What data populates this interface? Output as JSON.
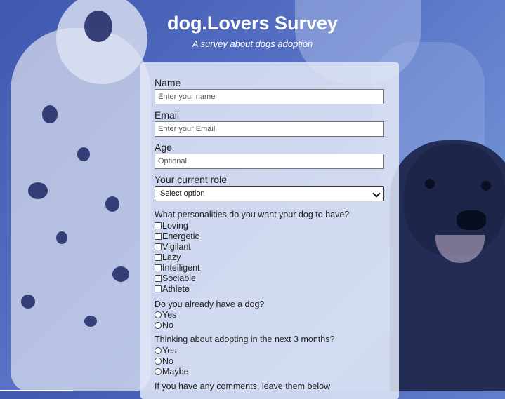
{
  "header": {
    "title": "dog.Lovers Survey",
    "subtitle": "A survey about dogs adoption"
  },
  "form": {
    "name": {
      "label": "Name",
      "placeholder": "Enter your name"
    },
    "email": {
      "label": "Email",
      "placeholder": "Enter your Email"
    },
    "age": {
      "label": "Age",
      "placeholder": "Optional"
    },
    "role": {
      "label": "Your current role",
      "selected": "Select option"
    },
    "personalities": {
      "question": "What personalities do you want your dog to have?",
      "options": [
        "Loving",
        "Energetic",
        "Vigilant",
        "Lazy",
        "Intelligent",
        "Sociable",
        "Athlete"
      ]
    },
    "have_dog": {
      "question": "Do you already have a dog?",
      "options": [
        "Yes",
        "No"
      ]
    },
    "adopting": {
      "question": "Thinking about adopting in the next 3 months?",
      "options": [
        "Yes",
        "No",
        "Maybe"
      ]
    },
    "comments": {
      "label": "If you have any comments, leave them below"
    }
  },
  "colors": {
    "background": "#5670c4",
    "card": "#e2e8f6",
    "title_text": "#ffffff"
  }
}
